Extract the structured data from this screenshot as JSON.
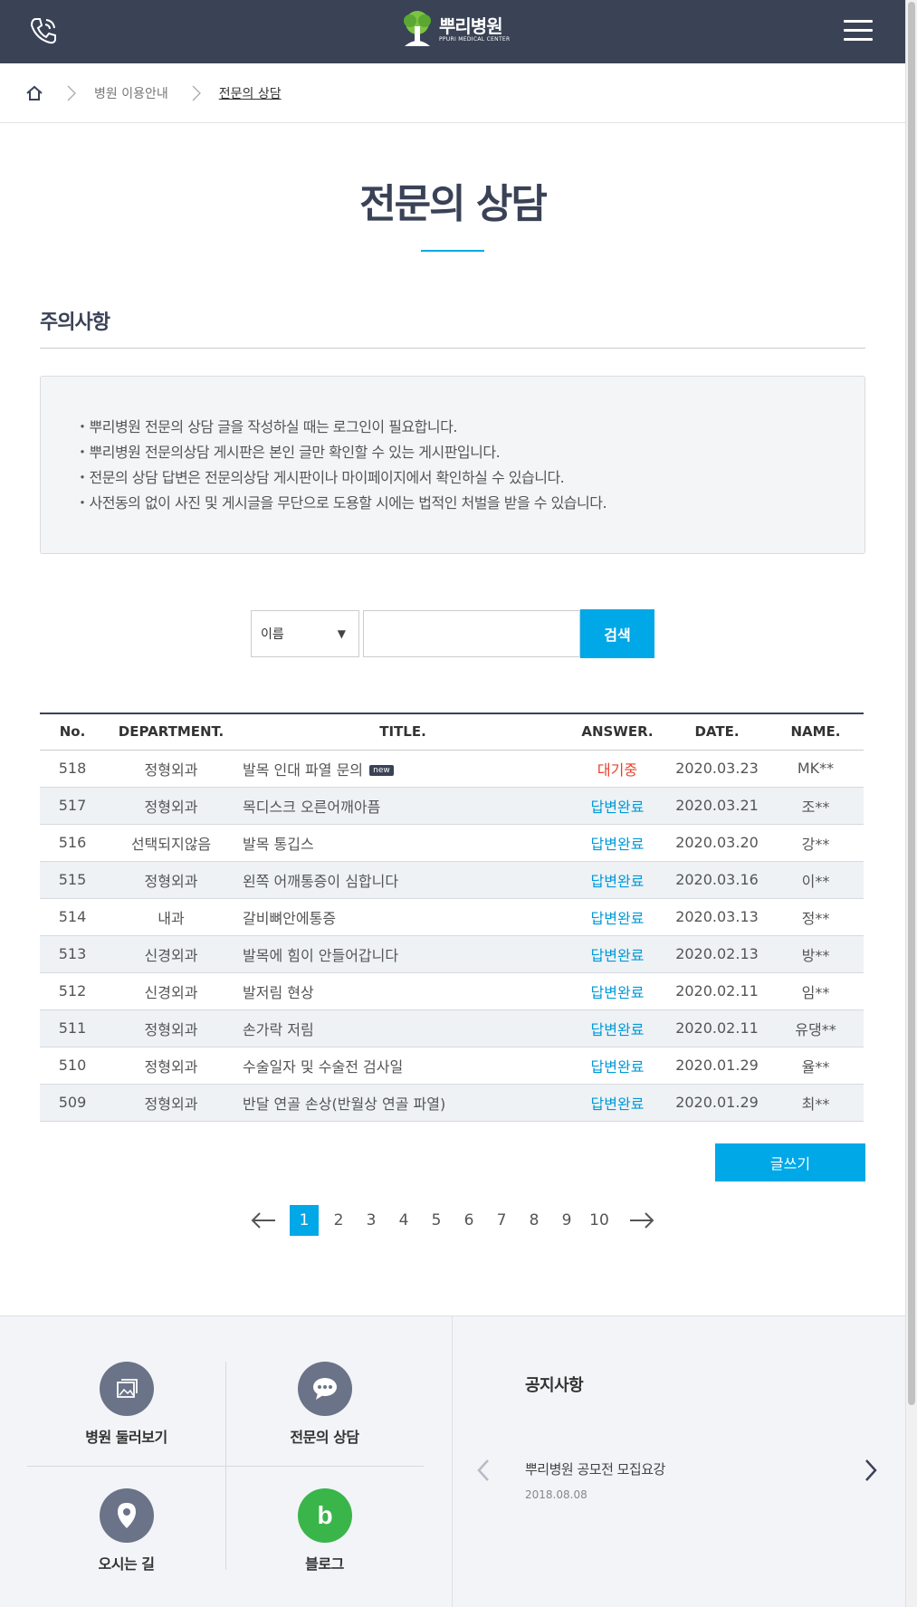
{
  "header": {
    "logo_main": "뿌리병원",
    "logo_sub": "PPURI MEDICAL CENTER"
  },
  "breadcrumb": {
    "level1": "병원 이용안내",
    "current": "전문의 상담"
  },
  "page_title": "전문의 상담",
  "notice": {
    "title": "주의사항",
    "items": [
      "・뿌리병원 전문의 상담 글을 작성하실 때는 로그인이 필요합니다.",
      "・뿌리병원 전문의상담 게시판은 본인 글만 확인할 수 있는 게시판입니다.",
      "・전문의 상담 답변은 전문의상담 게시판이나 마이페이지에서 확인하실 수 있습니다.",
      "・사전동의 없이 사진 및 게시글을 무단으로 도용할 시에는 법적인 처벌을 받을 수 있습니다."
    ]
  },
  "search": {
    "select_value": "이름",
    "input_value": "",
    "button_label": "검색"
  },
  "table": {
    "headers": [
      "No.",
      "DEPARTMENT.",
      "TITLE.",
      "ANSWER.",
      "DATE.",
      "NAME."
    ],
    "new_badge": "new",
    "rows": [
      {
        "no": "518",
        "dept": "정형외과",
        "title": "발목 인대 파열 문의",
        "answer": "대기중",
        "date": "2020.03.23",
        "name": "MK**"
      },
      {
        "no": "517",
        "dept": "정형외과",
        "title": "목디스크 오른어깨아픔",
        "answer": "답변완료",
        "date": "2020.03.21",
        "name": "조**"
      },
      {
        "no": "516",
        "dept": "선택되지않음",
        "title": "발목 통깁스",
        "answer": "답변완료",
        "date": "2020.03.20",
        "name": "강**"
      },
      {
        "no": "515",
        "dept": "정형외과",
        "title": "왼쪽 어깨통증이 심합니다",
        "answer": "답변완료",
        "date": "2020.03.16",
        "name": "이**"
      },
      {
        "no": "514",
        "dept": "내과",
        "title": "갈비뼈안에통증",
        "answer": "답변완료",
        "date": "2020.03.13",
        "name": "정**"
      },
      {
        "no": "513",
        "dept": "신경외과",
        "title": "발목에 힘이 안들어갑니다",
        "answer": "답변완료",
        "date": "2020.02.13",
        "name": "방**"
      },
      {
        "no": "512",
        "dept": "신경외과",
        "title": "발저림 현상",
        "answer": "답변완료",
        "date": "2020.02.11",
        "name": "임**"
      },
      {
        "no": "511",
        "dept": "정형외과",
        "title": "손가락 저림",
        "answer": "답변완료",
        "date": "2020.02.11",
        "name": "유댕**"
      },
      {
        "no": "510",
        "dept": "정형외과",
        "title": "수술일자 및 수술전 검사일",
        "answer": "답변완료",
        "date": "2020.01.29",
        "name": "율**"
      },
      {
        "no": "509",
        "dept": "정형외과",
        "title": "반달 연골 손상(반월상 연골 파열)",
        "answer": "답변완료",
        "date": "2020.01.29",
        "name": "최**"
      }
    ]
  },
  "write_button": "글쓰기",
  "pagination": {
    "pages": [
      "1",
      "2",
      "3",
      "4",
      "5",
      "6",
      "7",
      "8",
      "9",
      "10"
    ],
    "current": "1"
  },
  "footer": {
    "quick_links": {
      "tour": "병원 둘러보기",
      "consult": "전문의 상담",
      "directions": "오시는 길",
      "blog": "블로그"
    },
    "notice_panel": {
      "heading": "공지사항",
      "item_title": "뿌리병원 공모전 모집요강",
      "item_date": "2018.08.08"
    }
  },
  "colors": {
    "header_bg": "#3a4256",
    "accent": "#00a8e8",
    "waiting": "#e8402a",
    "answered": "#0099d8",
    "blog_green": "#3ab54a"
  }
}
